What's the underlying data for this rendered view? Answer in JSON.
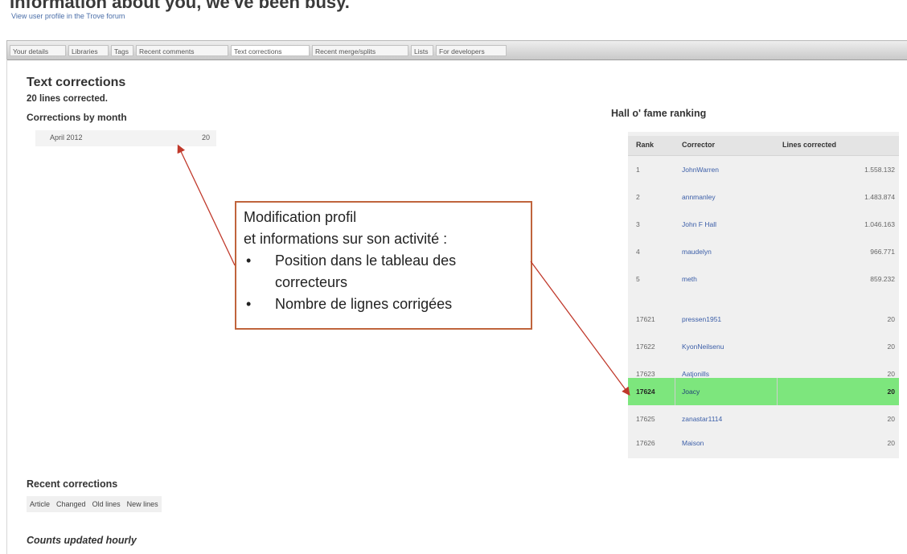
{
  "header": {
    "title": "Information about you, we've been busy.",
    "profile_link": "View user profile in the Trove forum"
  },
  "tabs": [
    {
      "label": "Your details"
    },
    {
      "label": "Libraries"
    },
    {
      "label": "Tags"
    },
    {
      "label": "Recent comments"
    },
    {
      "label": "Text corrections"
    },
    {
      "label": "Recent merge/splits"
    },
    {
      "label": "Lists"
    },
    {
      "label": "For developers"
    }
  ],
  "active_tab": "Text corrections",
  "text_corrections": {
    "heading": "Text corrections",
    "lines_corrected": "20 lines corrected.",
    "by_month_heading": "Corrections by month",
    "months": [
      {
        "month": "April 2012",
        "value": "20"
      }
    ]
  },
  "callout": {
    "line1": "Modification profil",
    "line2": "et informations sur son activité :",
    "bullet_char": "•",
    "bullets": [
      "Position dans le tableau des",
      "correcteurs",
      "Nombre de lignes corrigées"
    ],
    "border_color": "#c0643c"
  },
  "hall_of_fame": {
    "title": "Hall o' fame ranking",
    "columns": [
      "Rank",
      "Corrector",
      "Lines corrected"
    ],
    "rows": [
      {
        "rank": "1",
        "name": "JohnWarren",
        "lines": "1.558.132"
      },
      {
        "rank": "2",
        "name": "annmanley",
        "lines": "1.483.874"
      },
      {
        "rank": "3",
        "name": "John F Hall",
        "lines": "1.046.163"
      },
      {
        "rank": "4",
        "name": "maudelyn",
        "lines": "966.771"
      },
      {
        "rank": "5",
        "name": "meth",
        "lines": "859.232"
      },
      {
        "rank": "17621",
        "name": "pressen1951",
        "lines": "20"
      },
      {
        "rank": "17622",
        "name": "KyonNeilsenu",
        "lines": "20"
      },
      {
        "rank": "17623",
        "name": "Aatjonills",
        "lines": "20"
      },
      {
        "rank": "17624",
        "name": "Joacy",
        "lines": "20",
        "highlight": true
      },
      {
        "rank": "17625",
        "name": "zanastar1114",
        "lines": "20"
      },
      {
        "rank": "17626",
        "name": "Maison",
        "lines": "20"
      }
    ],
    "highlight_color": "#7de67d"
  },
  "recent_corrections": {
    "title": "Recent corrections",
    "columns": [
      "Article",
      "Changed",
      "Old lines",
      "New lines"
    ]
  },
  "footer": {
    "counts_updated": "Counts updated hourly"
  },
  "colors": {
    "arrow": "#c0392b",
    "link": "#3b5ea8"
  }
}
